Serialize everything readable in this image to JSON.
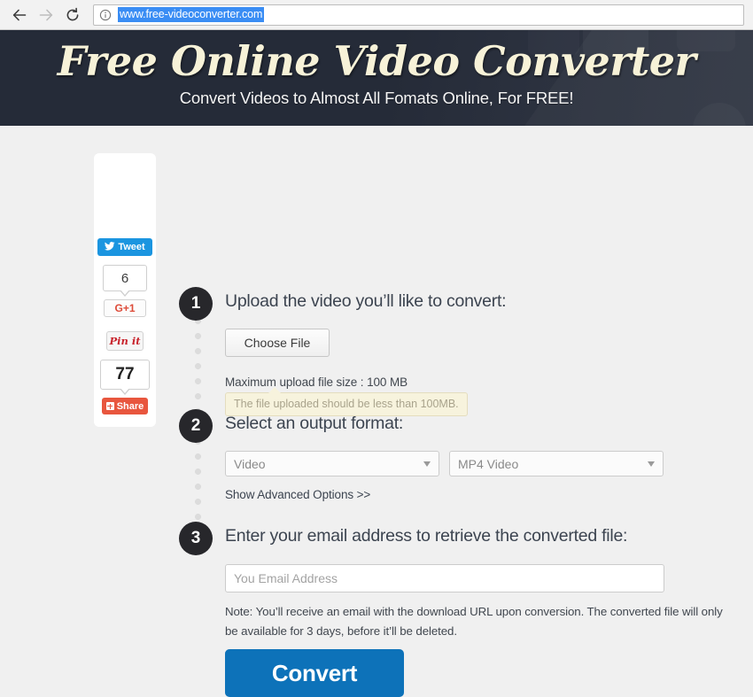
{
  "browser": {
    "back_icon": "back-arrow-icon",
    "forward_icon": "forward-arrow-icon",
    "reload_icon": "reload-icon",
    "info_icon": "info-circle-icon",
    "url": "www.free-videoconverter.com"
  },
  "hero": {
    "title": "Free Online Video Converter",
    "subtitle": "Convert Videos to Almost All Fomats Online, For FREE!",
    "bg_color": "#252b38",
    "title_color": "#f7f2d8"
  },
  "share": {
    "tweet_label": "Tweet",
    "tweet_count": "6",
    "gplus_label": "G+1",
    "pin_label": "Pin it",
    "share_count": "77",
    "share_label": "Share",
    "tweet_color": "#1b95e0",
    "share_color": "#e8563e",
    "gplus_color": "#dd4b39",
    "pin_color": "#c8232c"
  },
  "steps": [
    {
      "number": "1",
      "title": "Upload the video you’ll like to convert:",
      "choose_file_label": "Choose File",
      "max_size_text": "Maximum upload file size : 100 MB",
      "tooltip_text": "The file uploaded should be less than 100MB."
    },
    {
      "number": "2",
      "title": "Select an output format:",
      "format_category": "Video",
      "format_type": "MP4 Video",
      "advanced_link": "Show Advanced Options >>"
    },
    {
      "number": "3",
      "title": "Enter your email address to retrieve the converted file:",
      "email_placeholder": "You Email Address",
      "note": "Note: You’ll receive an email with the download URL upon conversion. The converted file will only be available for 3 days, before it’ll be deleted.",
      "convert_label": "Convert",
      "convert_color": "#0d72b9"
    }
  ]
}
